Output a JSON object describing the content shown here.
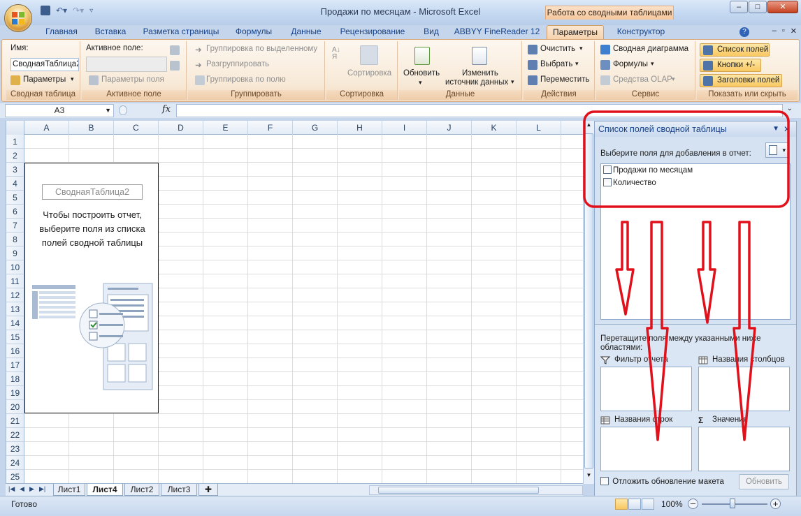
{
  "window": {
    "title": "Продажи по месяцам - Microsoft Excel",
    "context_title": "Работа со сводными таблицами",
    "buttons": {
      "minimize": "–",
      "maximize": "□",
      "close": "✕"
    }
  },
  "tabs": [
    "Главная",
    "Вставка",
    "Разметка страницы",
    "Формулы",
    "Данные",
    "Рецензирование",
    "Вид",
    "ABBYY FineReader 12",
    "Параметры",
    "Конструктор"
  ],
  "active_tab": "Параметры",
  "ribbon": {
    "pivot_table": {
      "name_label": "Имя:",
      "name_value": "СводнаяТаблица2",
      "options_button": "Параметры",
      "group_label": "Сводная таблица"
    },
    "active_field": {
      "label": "Активное поле:",
      "field_settings": "Параметры поля",
      "group_label": "Активное поле"
    },
    "group": {
      "group_selection": "Группировка по выделенному",
      "ungroup": "Разгруппировать",
      "group_field": "Группировка по полю",
      "group_label": "Группировать"
    },
    "sort": {
      "sort": "Сортировка",
      "group_label": "Сортировка"
    },
    "data": {
      "refresh": "Обновить",
      "change_source_line1": "Изменить",
      "change_source_line2": "источник данных",
      "group_label": "Данные"
    },
    "actions": {
      "clear": "Очистить",
      "select": "Выбрать",
      "move": "Переместить",
      "group_label": "Действия"
    },
    "tools": {
      "pivot_chart": "Сводная диаграмма",
      "formulas": "Формулы",
      "olap_tools": "Средства OLAP",
      "group_label": "Сервис"
    },
    "show_hide": {
      "field_list": "Список полей",
      "buttons": "Кнопки +/-",
      "field_headers": "Заголовки полей",
      "group_label": "Показать или скрыть"
    }
  },
  "formula_bar": {
    "name_box": "A3",
    "fx": "fx",
    "formula": ""
  },
  "sheet": {
    "columns": [
      "A",
      "B",
      "C",
      "D",
      "E",
      "F",
      "G",
      "H",
      "I",
      "J",
      "K",
      "L"
    ],
    "rows": [
      "1",
      "2",
      "3",
      "4",
      "5",
      "6",
      "7",
      "8",
      "9",
      "10",
      "11",
      "12",
      "13",
      "14",
      "15",
      "16",
      "17",
      "18",
      "19",
      "20",
      "21",
      "22",
      "23",
      "24",
      "25"
    ],
    "pivot_placeholder": {
      "name": "СводнаяТаблица2",
      "instruction": "Чтобы построить отчет, выберите поля из списка полей сводной таблицы"
    }
  },
  "sheet_tabs": [
    "Лист1",
    "Лист4",
    "Лист2",
    "Лист3"
  ],
  "active_sheet": "Лист4",
  "field_list": {
    "title": "Список полей сводной таблицы",
    "choose_label": "Выберите поля для добавления в отчет:",
    "fields": [
      {
        "name": "Продажи по месяцам",
        "checked": false
      },
      {
        "name": "Количество",
        "checked": false
      }
    ],
    "drag_label": "Перетащите поля между указанными ниже областями:",
    "areas": {
      "report_filter": "Фильтр отчета",
      "column_labels": "Названия столбцов",
      "row_labels": "Названия строк",
      "values": "Значения"
    },
    "defer_update": "Отложить обновление макета",
    "update_button": "Обновить"
  },
  "status_bar": {
    "status": "Готово",
    "zoom": "100%"
  },
  "colors": {
    "annotation_red": "#e0111b",
    "ribbon_accent": "#f9c862",
    "title_blue": "#15428b"
  }
}
